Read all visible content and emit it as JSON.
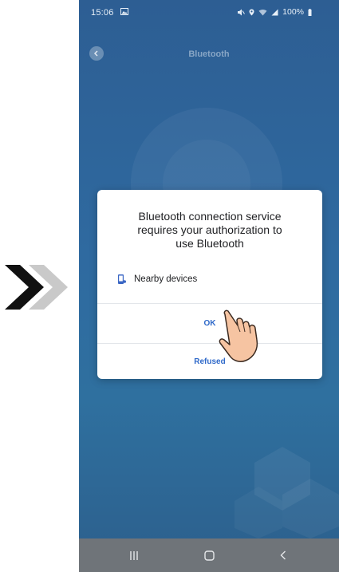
{
  "status_bar": {
    "time": "15:06",
    "battery": "100%"
  },
  "header": {
    "title": "Bluetooth"
  },
  "dialog": {
    "message": "Bluetooth connection service\nrequires your authorization to\nuse Bluetooth",
    "permission_label": "Nearby devices",
    "ok_label": "OK",
    "refused_label": "Refused"
  },
  "icons": {
    "guide": "double-chevron-right-icon",
    "permission": "nearby-devices-icon",
    "pointer": "tapping-hand-icon"
  },
  "colors": {
    "background_top": "#2d5e93",
    "background_bottom": "#2c5f8c",
    "button_text": "#2f69c9",
    "nav_bar": "#6f7479"
  }
}
